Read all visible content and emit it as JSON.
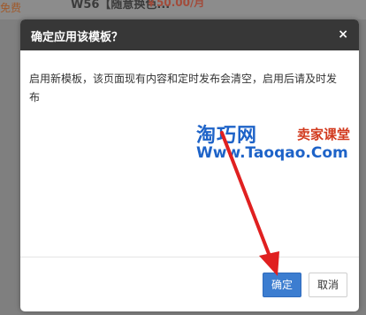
{
  "background": {
    "left_text": "免费",
    "item_title": "W56【随意换色...",
    "price": "￥50.00/月"
  },
  "dialog": {
    "title": "确定应用该模板？",
    "close_glyph": "×",
    "message": "启用新模板，该页面现有内容和定时发布会清空，启用后请及时发布",
    "confirm_label": "确定",
    "cancel_label": "取消"
  },
  "watermark": {
    "brand": "淘巧网",
    "subtitle": "卖家课堂",
    "url": "Www.Taoqao.Com"
  },
  "colors": {
    "header_bg": "#373737",
    "confirm_bg": "#3c7dd0",
    "arrow": "#e02020",
    "watermark_blue": "#1e63c8",
    "watermark_red": "#d23a1e"
  },
  "icons": {
    "close": "close-icon",
    "annotation": "red-arrow-annotation"
  }
}
